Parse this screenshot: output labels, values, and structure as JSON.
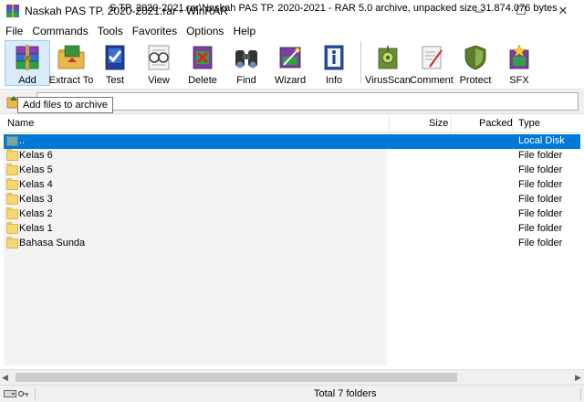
{
  "window": {
    "title": "Naskah PAS TP. 2020-2021.rar - WinRAR",
    "controls": {
      "minimize": "─",
      "maximize": "☐",
      "close": "✕"
    }
  },
  "menu": [
    "File",
    "Commands",
    "Tools",
    "Favorites",
    "Options",
    "Help"
  ],
  "toolbar": {
    "buttons": [
      {
        "label": "Add",
        "icon": "books-archive-icon"
      },
      {
        "label": "Extract To",
        "icon": "folder-extract-icon"
      },
      {
        "label": "Test",
        "icon": "test-book-icon"
      },
      {
        "label": "View",
        "icon": "glasses-view-icon"
      },
      {
        "label": "Delete",
        "icon": "delete-icon"
      },
      {
        "label": "Find",
        "icon": "binoculars-icon"
      },
      {
        "label": "Wizard",
        "icon": "wizard-wand-icon"
      },
      {
        "label": "Info",
        "icon": "info-icon"
      },
      {
        "label": "VirusScan",
        "icon": "virus-scan-icon"
      },
      {
        "label": "Comment",
        "icon": "comment-pen-icon"
      },
      {
        "label": "Protect",
        "icon": "shield-protect-icon"
      },
      {
        "label": "SFX",
        "icon": "sfx-archive-icon"
      }
    ]
  },
  "tooltip": "Add files to archive",
  "address": {
    "text": "S TP. 2020-2021.rar\\Naskah PAS TP. 2020-2021 - RAR 5.0 archive, unpacked size 31.874.076 bytes"
  },
  "columns": {
    "name": "Name",
    "size": "Size",
    "packed": "Packed",
    "type": "Type"
  },
  "rows": [
    {
      "name": "..",
      "type": "Local Disk",
      "kind": "updir",
      "selected": true
    },
    {
      "name": "Kelas 6",
      "type": "File folder",
      "kind": "folder"
    },
    {
      "name": "Kelas 5",
      "type": "File folder",
      "kind": "folder"
    },
    {
      "name": "Kelas 4",
      "type": "File folder",
      "kind": "folder"
    },
    {
      "name": "Kelas 3",
      "type": "File folder",
      "kind": "folder"
    },
    {
      "name": "Kelas 2",
      "type": "File folder",
      "kind": "folder"
    },
    {
      "name": "Kelas 1",
      "type": "File folder",
      "kind": "folder"
    },
    {
      "name": "Bahasa Sunda",
      "type": "File folder",
      "kind": "folder"
    }
  ],
  "status": {
    "text": "Total 7 folders"
  },
  "colors": {
    "selection": "#0078d7",
    "folder": "#f7d674"
  }
}
